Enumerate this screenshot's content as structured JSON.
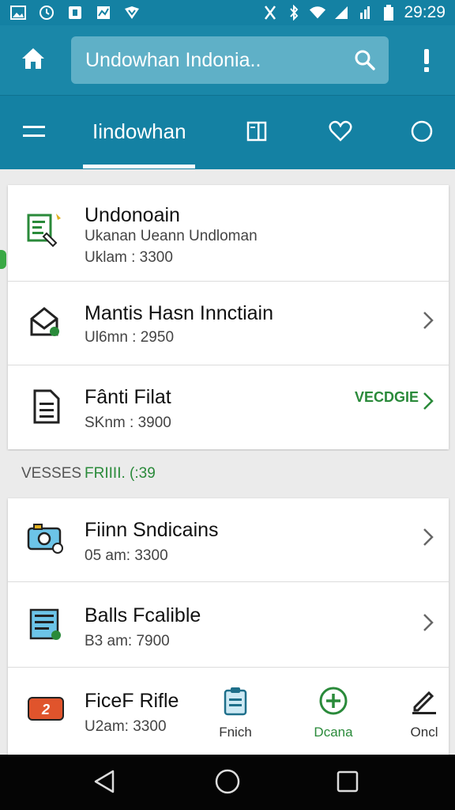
{
  "status_bar": {
    "time": "29:29"
  },
  "search": {
    "placeholder": "Undowhan Indonia.."
  },
  "tabs": {
    "active_label": "Iindowhan"
  },
  "card1": {
    "rows": [
      {
        "title": "Undonoain",
        "subtitle": "Ukanan Ueann Undloman",
        "meta": "Uklam : 3300"
      },
      {
        "title": "Mantis Hasn Innctiain",
        "subtitle": "Ul6mn : 2950"
      },
      {
        "title": "Fânti Filat",
        "subtitle": "SKnm : 3900",
        "badge": "VECDGIE"
      }
    ]
  },
  "section": {
    "label_gray": "VESSES",
    "label_green": "FRIIII. (:39"
  },
  "card2": {
    "rows": [
      {
        "title": "Fiinn Sndicains",
        "subtitle": "05 am: 3300"
      },
      {
        "title": "Balls Fcalible",
        "subtitle": "B3 am: 7900"
      },
      {
        "title": "FiceF Rifle",
        "subtitle": "U2am: 3300"
      }
    ]
  },
  "bottom_actions": [
    {
      "label": "Fnich"
    },
    {
      "label": "Dcana"
    },
    {
      "label": "Oncl"
    }
  ],
  "colors": {
    "primary": "#1481a3",
    "appbar": "#1a87a8",
    "accent_green": "#2a8a3a"
  }
}
